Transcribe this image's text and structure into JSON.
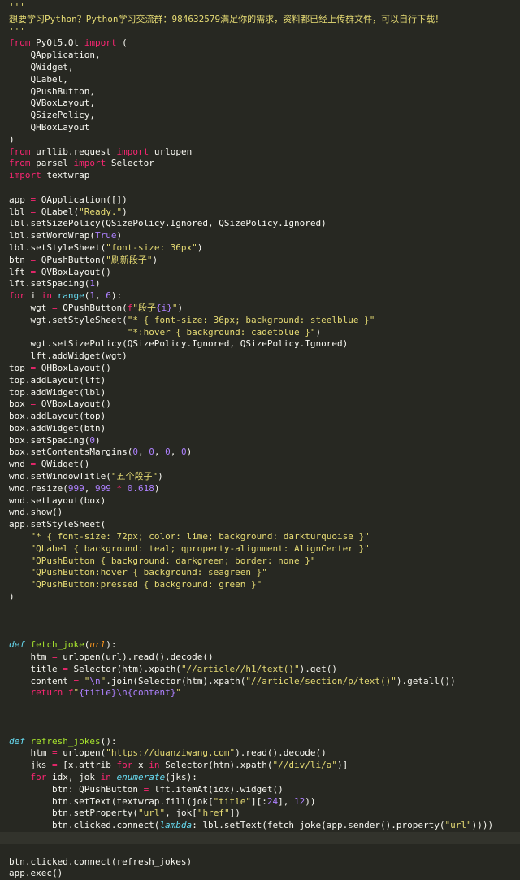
{
  "editor": {
    "theme_colors": {
      "background": "#272822",
      "plain": "#f8f8f2",
      "keyword": "#f92672",
      "string": "#e6db74",
      "number": "#ae81ff",
      "builtin": "#66d9ef",
      "function_name": "#a6e22e",
      "parameter": "#fd971f"
    },
    "active_line": 69,
    "lines": [
      [
        [
          "c",
          "'''"
        ]
      ],
      [
        [
          "c",
          "想要学习Python？Python学习交流群：984632579满足你的需求，资料都已经上传群文件，可以自行下载！"
        ]
      ],
      [
        [
          "c",
          "'''"
        ]
      ],
      [
        [
          "k",
          "from"
        ],
        [
          "p",
          " PyQt5.Qt "
        ],
        [
          "k",
          "import"
        ],
        [
          "p",
          " ("
        ]
      ],
      [
        [
          "p",
          "    QApplication,"
        ]
      ],
      [
        [
          "p",
          "    QWidget,"
        ]
      ],
      [
        [
          "p",
          "    QLabel,"
        ]
      ],
      [
        [
          "p",
          "    QPushButton,"
        ]
      ],
      [
        [
          "p",
          "    QVBoxLayout,"
        ]
      ],
      [
        [
          "p",
          "    QSizePolicy,"
        ]
      ],
      [
        [
          "p",
          "    QHBoxLayout"
        ]
      ],
      [
        [
          "p",
          ")"
        ]
      ],
      [
        [
          "k",
          "from"
        ],
        [
          "p",
          " urllib.request "
        ],
        [
          "k",
          "import"
        ],
        [
          "p",
          " urlopen"
        ]
      ],
      [
        [
          "k",
          "from"
        ],
        [
          "p",
          " parsel "
        ],
        [
          "k",
          "import"
        ],
        [
          "p",
          " Selector"
        ]
      ],
      [
        [
          "k",
          "import"
        ],
        [
          "p",
          " textwrap"
        ]
      ],
      [],
      [
        [
          "p",
          "app "
        ],
        [
          "k",
          "="
        ],
        [
          "p",
          " QApplication([])"
        ]
      ],
      [
        [
          "p",
          "lbl "
        ],
        [
          "k",
          "="
        ],
        [
          "p",
          " QLabel("
        ],
        [
          "s",
          "\"Ready.\""
        ],
        [
          "p",
          ")"
        ]
      ],
      [
        [
          "p",
          "lbl.setSizePolicy(QSizePolicy.Ignored, QSizePolicy.Ignored)"
        ]
      ],
      [
        [
          "p",
          "lbl.setWordWrap("
        ],
        [
          "n",
          "True"
        ],
        [
          "p",
          ")"
        ]
      ],
      [
        [
          "p",
          "lbl.setStyleSheet("
        ],
        [
          "s",
          "\"font-size: 36px\""
        ],
        [
          "p",
          ")"
        ]
      ],
      [
        [
          "p",
          "btn "
        ],
        [
          "k",
          "="
        ],
        [
          "p",
          " QPushButton("
        ],
        [
          "s",
          "\"刷新段子\""
        ],
        [
          "p",
          ")"
        ]
      ],
      [
        [
          "p",
          "lft "
        ],
        [
          "k",
          "="
        ],
        [
          "p",
          " QVBoxLayout()"
        ]
      ],
      [
        [
          "p",
          "lft.setSpacing("
        ],
        [
          "n",
          "1"
        ],
        [
          "p",
          ")"
        ]
      ],
      [
        [
          "k",
          "for"
        ],
        [
          "p",
          " i "
        ],
        [
          "k",
          "in"
        ],
        [
          "p",
          " "
        ],
        [
          "b",
          "range"
        ],
        [
          "p",
          "("
        ],
        [
          "n",
          "1"
        ],
        [
          "p",
          ", "
        ],
        [
          "n",
          "6"
        ],
        [
          "p",
          "):"
        ]
      ],
      [
        [
          "p",
          "    wgt "
        ],
        [
          "k",
          "="
        ],
        [
          "p",
          " QPushButton("
        ],
        [
          "k",
          "f"
        ],
        [
          "s",
          "\"段子"
        ],
        [
          "n",
          "{i}"
        ],
        [
          "s",
          "\""
        ],
        [
          "p",
          ")"
        ]
      ],
      [
        [
          "p",
          "    wgt.setStyleSheet("
        ],
        [
          "s",
          "\"* { font-size: 36px; background: steelblue }\""
        ]
      ],
      [
        [
          "p",
          "                      "
        ],
        [
          "s",
          "\"*:hover { background: cadetblue }\""
        ],
        [
          "p",
          ")"
        ]
      ],
      [
        [
          "p",
          "    wgt.setSizePolicy(QSizePolicy.Ignored, QSizePolicy.Ignored)"
        ]
      ],
      [
        [
          "p",
          "    lft.addWidget(wgt)"
        ]
      ],
      [
        [
          "p",
          "top "
        ],
        [
          "k",
          "="
        ],
        [
          "p",
          " QHBoxLayout()"
        ]
      ],
      [
        [
          "p",
          "top.addLayout(lft)"
        ]
      ],
      [
        [
          "p",
          "top.addWidget(lbl)"
        ]
      ],
      [
        [
          "p",
          "box "
        ],
        [
          "k",
          "="
        ],
        [
          "p",
          " QVBoxLayout()"
        ]
      ],
      [
        [
          "p",
          "box.addLayout(top)"
        ]
      ],
      [
        [
          "p",
          "box.addWidget(btn)"
        ]
      ],
      [
        [
          "p",
          "box.setSpacing("
        ],
        [
          "n",
          "0"
        ],
        [
          "p",
          ")"
        ]
      ],
      [
        [
          "p",
          "box.setContentsMargins("
        ],
        [
          "n",
          "0"
        ],
        [
          "p",
          ", "
        ],
        [
          "n",
          "0"
        ],
        [
          "p",
          ", "
        ],
        [
          "n",
          "0"
        ],
        [
          "p",
          ", "
        ],
        [
          "n",
          "0"
        ],
        [
          "p",
          ")"
        ]
      ],
      [
        [
          "p",
          "wnd "
        ],
        [
          "k",
          "="
        ],
        [
          "p",
          " QWidget()"
        ]
      ],
      [
        [
          "p",
          "wnd.setWindowTitle("
        ],
        [
          "s",
          "\"五个段子\""
        ],
        [
          "p",
          ")"
        ]
      ],
      [
        [
          "p",
          "wnd.resize("
        ],
        [
          "n",
          "999"
        ],
        [
          "p",
          ", "
        ],
        [
          "n",
          "999"
        ],
        [
          "p",
          " "
        ],
        [
          "k",
          "*"
        ],
        [
          "p",
          " "
        ],
        [
          "n",
          "0.618"
        ],
        [
          "p",
          ")"
        ]
      ],
      [
        [
          "p",
          "wnd.setLayout(box)"
        ]
      ],
      [
        [
          "p",
          "wnd.show()"
        ]
      ],
      [
        [
          "p",
          "app.setStyleSheet("
        ]
      ],
      [
        [
          "p",
          "    "
        ],
        [
          "s",
          "\"* { font-size: 72px; color: lime; background: darkturquoise }\""
        ]
      ],
      [
        [
          "p",
          "    "
        ],
        [
          "s",
          "\"QLabel { background: teal; qproperty-alignment: AlignCenter }\""
        ]
      ],
      [
        [
          "p",
          "    "
        ],
        [
          "s",
          "\"QPushButton { background: darkgreen; border: none }\""
        ]
      ],
      [
        [
          "p",
          "    "
        ],
        [
          "s",
          "\"QPushButton:hover { background: seagreen }\""
        ]
      ],
      [
        [
          "p",
          "    "
        ],
        [
          "s",
          "\"QPushButton:pressed { background: green }\""
        ]
      ],
      [
        [
          "p",
          ")"
        ]
      ],
      [],
      [],
      [],
      [
        [
          "d",
          "def"
        ],
        [
          "p",
          " "
        ],
        [
          "f",
          "fetch_joke"
        ],
        [
          "p",
          "("
        ],
        [
          "a",
          "url"
        ],
        [
          "p",
          "):"
        ]
      ],
      [
        [
          "p",
          "    htm "
        ],
        [
          "k",
          "="
        ],
        [
          "p",
          " urlopen(url).read().decode()"
        ]
      ],
      [
        [
          "p",
          "    title "
        ],
        [
          "k",
          "="
        ],
        [
          "p",
          " Selector(htm).xpath("
        ],
        [
          "s",
          "\"//article//h1/text()\""
        ],
        [
          "p",
          ").get()"
        ]
      ],
      [
        [
          "p",
          "    content "
        ],
        [
          "k",
          "="
        ],
        [
          "p",
          " "
        ],
        [
          "s",
          "\""
        ],
        [
          "n",
          "\\n"
        ],
        [
          "s",
          "\""
        ],
        [
          "p",
          ".join(Selector(htm).xpath("
        ],
        [
          "s",
          "\"//article/section/p/text()\""
        ],
        [
          "p",
          ").getall())"
        ]
      ],
      [
        [
          "p",
          "    "
        ],
        [
          "k",
          "return"
        ],
        [
          "p",
          " "
        ],
        [
          "k",
          "f"
        ],
        [
          "s",
          "\""
        ],
        [
          "n",
          "{title}"
        ],
        [
          "n",
          "\\n"
        ],
        [
          "n",
          "{content}"
        ],
        [
          "s",
          "\""
        ]
      ],
      [],
      [],
      [],
      [
        [
          "d",
          "def"
        ],
        [
          "p",
          " "
        ],
        [
          "f",
          "refresh_jokes"
        ],
        [
          "p",
          "():"
        ]
      ],
      [
        [
          "p",
          "    htm "
        ],
        [
          "k",
          "="
        ],
        [
          "p",
          " urlopen("
        ],
        [
          "s",
          "\"https://duanziwang.com\""
        ],
        [
          "p",
          ").read().decode()"
        ]
      ],
      [
        [
          "p",
          "    jks "
        ],
        [
          "k",
          "="
        ],
        [
          "p",
          " [x.attrib "
        ],
        [
          "k",
          "for"
        ],
        [
          "p",
          " x "
        ],
        [
          "k",
          "in"
        ],
        [
          "p",
          " Selector(htm).xpath("
        ],
        [
          "s",
          "\"//div/li/a\""
        ],
        [
          "p",
          ")]"
        ]
      ],
      [
        [
          "p",
          "    "
        ],
        [
          "k",
          "for"
        ],
        [
          "p",
          " idx, jok "
        ],
        [
          "k",
          "in"
        ],
        [
          "p",
          " "
        ],
        [
          "i",
          "enumerate"
        ],
        [
          "p",
          "(jks):"
        ]
      ],
      [
        [
          "p",
          "        btn: QPushButton "
        ],
        [
          "k",
          "="
        ],
        [
          "p",
          " lft.itemAt(idx).widget()"
        ]
      ],
      [
        [
          "p",
          "        btn.setText(textwrap.fill(jok["
        ],
        [
          "s",
          "\"title\""
        ],
        [
          "p",
          "][:"
        ],
        [
          "n",
          "24"
        ],
        [
          "p",
          "], "
        ],
        [
          "n",
          "12"
        ],
        [
          "p",
          "))"
        ]
      ],
      [
        [
          "p",
          "        btn.setProperty("
        ],
        [
          "s",
          "\"url\""
        ],
        [
          "p",
          ", jok["
        ],
        [
          "s",
          "\"href\""
        ],
        [
          "p",
          "])"
        ]
      ],
      [
        [
          "p",
          "        btn.clicked.connect("
        ],
        [
          "i",
          "lambda"
        ],
        [
          "p",
          ": lbl.setText(fetch_joke(app.sender().property("
        ],
        [
          "s",
          "\"url\""
        ],
        [
          "p",
          "))))"
        ]
      ],
      [],
      [],
      [
        [
          "p",
          "btn.clicked.connect(refresh_jokes)"
        ]
      ],
      [
        [
          "p",
          "app.exec()"
        ]
      ]
    ]
  }
}
